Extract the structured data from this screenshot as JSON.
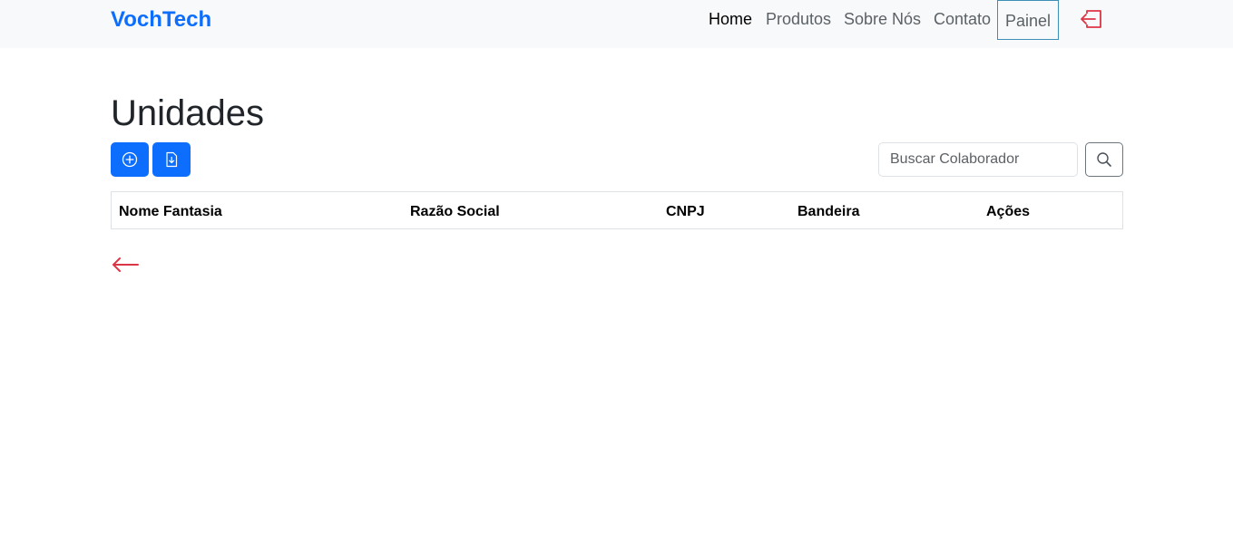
{
  "navbar": {
    "brand": "VochTech",
    "links": [
      {
        "label": "Home"
      },
      {
        "label": "Produtos"
      },
      {
        "label": "Sobre Nós"
      },
      {
        "label": "Contato"
      },
      {
        "label": "Painel"
      }
    ],
    "logout_icon": "box-arrow-left-icon"
  },
  "page": {
    "title": "Unidades"
  },
  "toolbar": {
    "add_icon": "plus-circle-icon",
    "export_icon": "file-arrow-down-icon",
    "search_placeholder": "Buscar Colaborador",
    "search_icon": "search-icon"
  },
  "table": {
    "columns": [
      "Nome Fantasia",
      "Razão Social",
      "CNPJ",
      "Bandeira",
      "Ações"
    ],
    "rows": []
  },
  "back_icon": "arrow-left-icon",
  "colors": {
    "brand": "#0d6efd",
    "primary_button": "#0d6efd",
    "danger_icon": "#dc3545",
    "navbar_bg": "#f8f9fa",
    "active_outline": "#3d8fb8"
  }
}
